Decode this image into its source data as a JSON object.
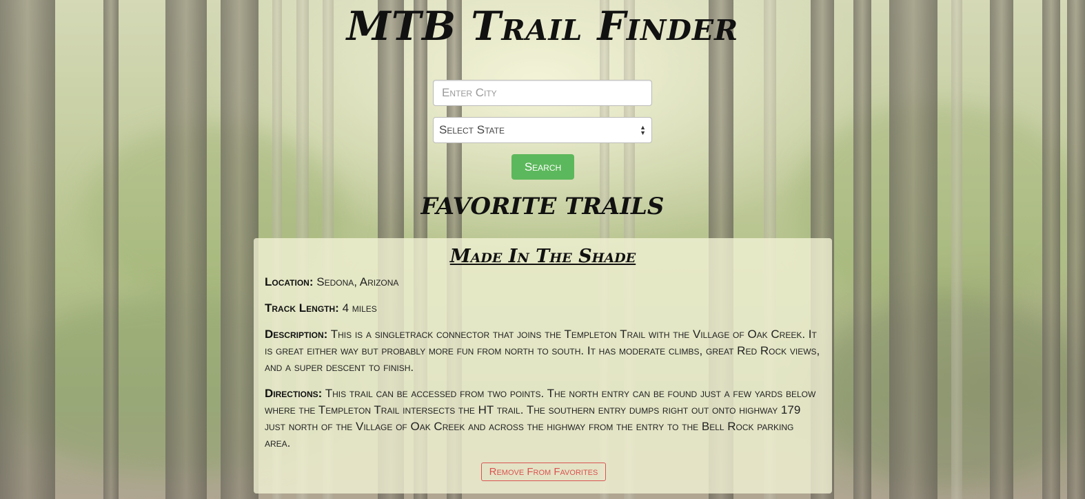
{
  "header": {
    "title": "MTB Trail Finder"
  },
  "search": {
    "city_placeholder": "Enter City",
    "city_value": "",
    "state_selected": "Select State",
    "search_label": "Search"
  },
  "favorites": {
    "heading": "Favorite Trails",
    "trails": [
      {
        "name": "Made In The Shade",
        "location_label": "Location:",
        "location": "Sedona, Arizona",
        "length_label": "Track Length:",
        "length": "4 miles",
        "description_label": "Description:",
        "description": "This is a singletrack connector that joins the Templeton Trail with the Village of Oak Creek. It is great either way but probably more fun from north to south. It has moderate climbs, great Red Rock views, and a super descent to finish.",
        "directions_label": "Directions:",
        "directions": "This trail can be accessed from two points. The north entry can be found just a few yards below where the Templeton Trail intersects the HT trail. The southern entry dumps right out onto highway 179 just north of the Village of Oak Creek and across the highway from the entry to the Bell Rock parking area.",
        "remove_label": "Remove From Favorites"
      }
    ]
  },
  "colors": {
    "search_button": "#5cb85c",
    "remove_button": "#d9534f",
    "card_background": "#f4f4d6"
  }
}
